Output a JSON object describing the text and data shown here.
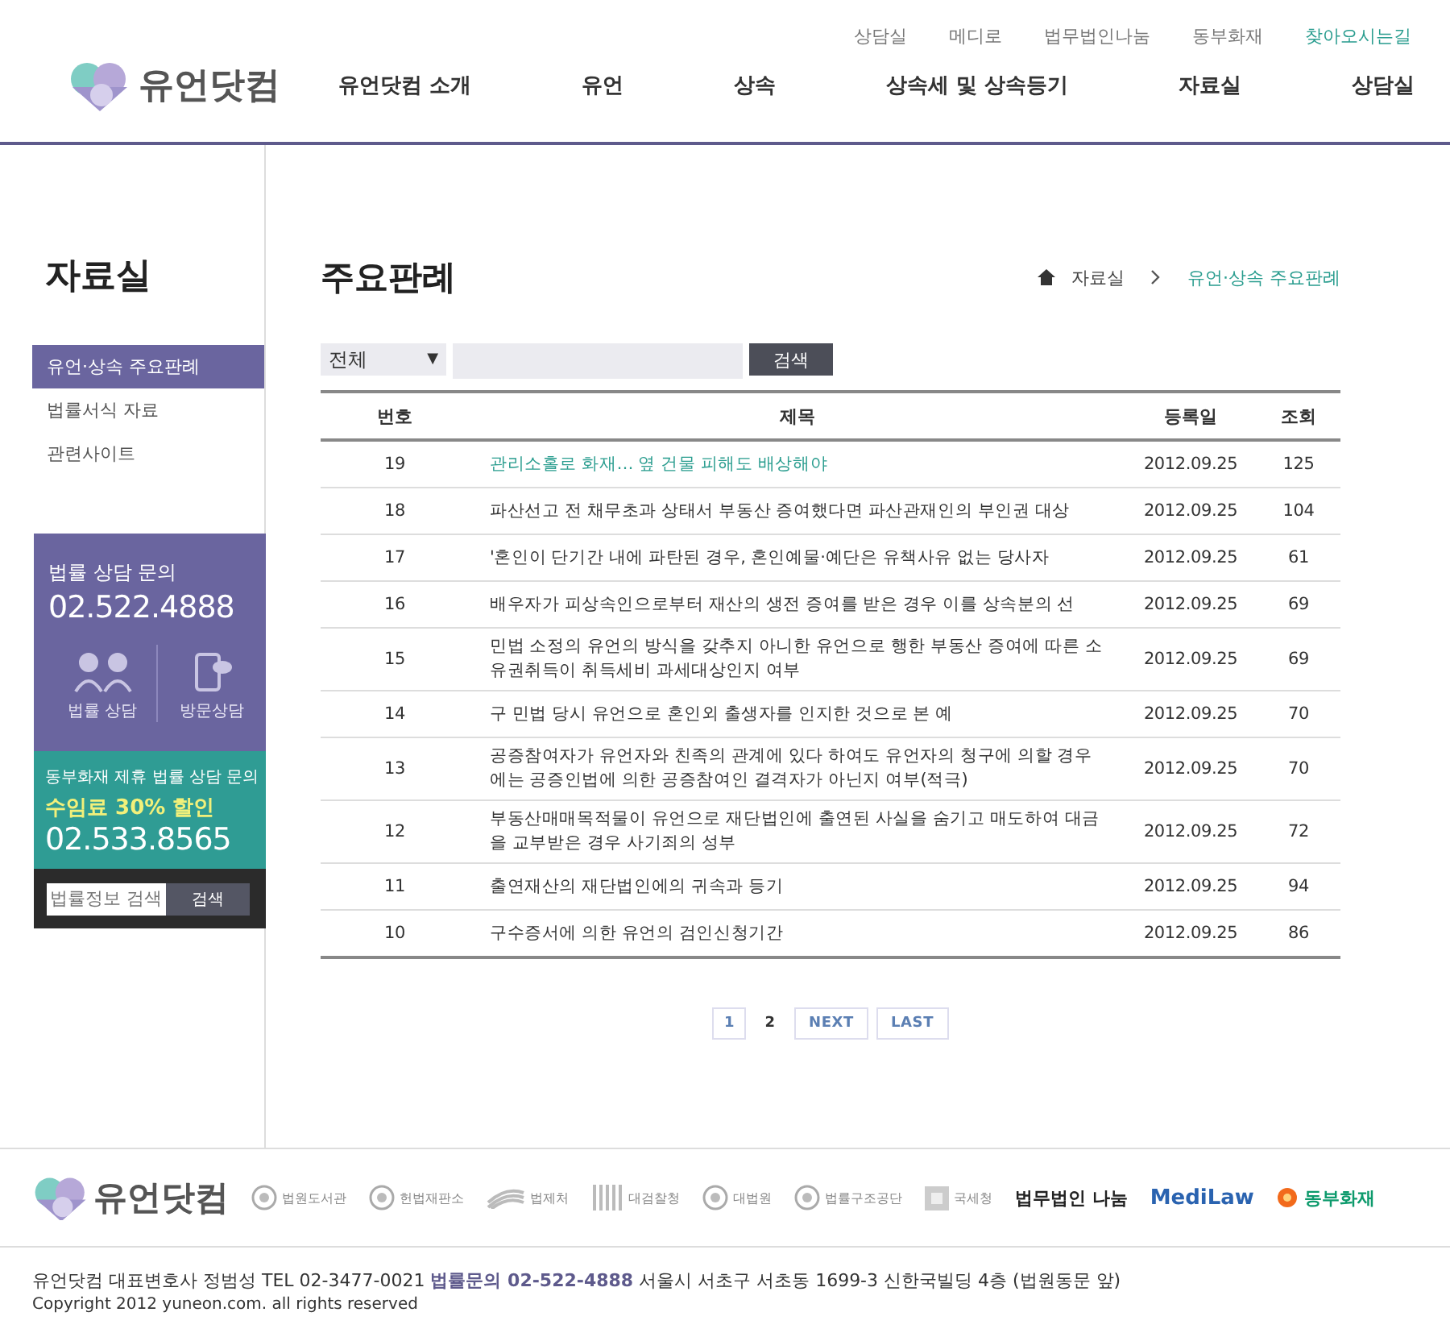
{
  "header": {
    "logo": "유언닷컴",
    "util_links": [
      {
        "label": "상담실",
        "highlighted": false
      },
      {
        "label": "메디로",
        "highlighted": false
      },
      {
        "label": "법무법인나눔",
        "highlighted": false
      },
      {
        "label": "동부화재",
        "highlighted": false
      },
      {
        "label": "찾아오시는길",
        "highlighted": true
      }
    ],
    "nav": [
      "유언닷컴 소개",
      "유언",
      "상속",
      "상속세 및 상속등기",
      "자료실",
      "상담실"
    ]
  },
  "sidebar": {
    "title": "자료실",
    "items": [
      {
        "label": "유언·상속 주요판례",
        "selected": true
      },
      {
        "label": "법률서식 자료",
        "selected": false
      },
      {
        "label": "관련사이트",
        "selected": false
      }
    ],
    "consult": {
      "caption": "법률 상담 문의",
      "phone": "02.522.4888",
      "actions": [
        {
          "label": "법률 상담",
          "kind": "people"
        },
        {
          "label": "방문상담",
          "kind": "phone"
        }
      ]
    },
    "partner": {
      "caption": "동부화재 제휴 법률 상담 문의",
      "offer": "수임료 30% 할인",
      "phone": "02.533.8565"
    },
    "search": {
      "placeholder": "법률정보 검색",
      "button": "검색"
    }
  },
  "main": {
    "title": "주요판례",
    "breadcrumb": [
      "자료실",
      "유언·상속 주요판례"
    ],
    "filter": {
      "value": "전체",
      "caret": "▼",
      "button": "검색"
    },
    "table": {
      "columns": [
        "번호",
        "제목",
        "등록일",
        "조회"
      ],
      "rows": [
        {
          "no": "19",
          "title": "관리소홀로 화재… 옆 건물 피해도 배상해야",
          "date": "2012.09.25",
          "views": "125",
          "highlighted": true
        },
        {
          "no": "18",
          "title": "파산선고 전 채무초과 상태서 부동산 증여했다면 파산관재인의 부인권 대상",
          "date": "2012.09.25",
          "views": "104",
          "highlighted": false
        },
        {
          "no": "17",
          "title": "'혼인이 단기간 내에 파탄된 경우, 혼인예물·예단은 유책사유 없는 당사자",
          "date": "2012.09.25",
          "views": "61",
          "highlighted": false
        },
        {
          "no": "16",
          "title": "배우자가 피상속인으로부터 재산의 생전 증여를 받은 경우 이를 상속분의 선",
          "date": "2012.09.25",
          "views": "69",
          "highlighted": false
        },
        {
          "no": "15",
          "title": "민법 소정의 유언의 방식을 갖추지 아니한 유언으로 행한 부동산 증여에 따른 소유권취득이 취득세비 과세대상인지 여부",
          "date": "2012.09.25",
          "views": "69",
          "highlighted": false
        },
        {
          "no": "14",
          "title": "구 민법 당시 유언으로 혼인외 출생자를 인지한 것으로 본 예",
          "date": "2012.09.25",
          "views": "70",
          "highlighted": false
        },
        {
          "no": "13",
          "title": "공증참여자가 유언자와 친족의 관계에 있다 하여도 유언자의 청구에 의할 경우에는 공증인법에 의한 공증참여인 결격자가 아닌지 여부(적극)",
          "date": "2012.09.25",
          "views": "70",
          "highlighted": false
        },
        {
          "no": "12",
          "title": "부동산매매목적물이 유언으로 재단법인에 출연된 사실을 숨기고 매도하여 대금을 교부받은 경우 사기죄의 성부",
          "date": "2012.09.25",
          "views": "72",
          "highlighted": false
        },
        {
          "no": "11",
          "title": "출연재산의 재단법인에의 귀속과 등기",
          "date": "2012.09.25",
          "views": "94",
          "highlighted": false
        },
        {
          "no": "10",
          "title": "구수증서에 의한 유언의 검인신청기간",
          "date": "2012.09.25",
          "views": "86",
          "highlighted": false
        }
      ]
    },
    "pagination": [
      {
        "label": "1",
        "selected": false,
        "kind": "page"
      },
      {
        "label": "2",
        "selected": true,
        "kind": "page"
      },
      {
        "label": "NEXT",
        "selected": false,
        "kind": "nav"
      },
      {
        "label": "LAST",
        "selected": false,
        "kind": "nav"
      }
    ]
  },
  "footer": {
    "logo": "유언닷컴",
    "partners": [
      {
        "label": "법원도서관",
        "kind": "seal"
      },
      {
        "label": "헌법재판소",
        "kind": "seal"
      },
      {
        "label": "법제처",
        "kind": "wave"
      },
      {
        "label": "대검찰청",
        "kind": "bars"
      },
      {
        "label": "대법원",
        "kind": "seal"
      },
      {
        "label": "법률구조공단",
        "kind": "seal"
      },
      {
        "label": "국세청",
        "kind": "square"
      },
      {
        "label": "법무법인 나눔",
        "kind": "text"
      },
      {
        "label": "MediLaw",
        "kind": "medilaw"
      },
      {
        "label": "동부화재",
        "kind": "flower"
      }
    ],
    "address_parts": [
      "유언닷컴 대표변호사 정범성 TEL 02-3477-0021",
      "법률문의 02-522-4888",
      "서울시 서초구 서초동 1699-3 신한국빌딩 4층 (법원동문 앞)"
    ],
    "copyright": "Copyright 2012 yuneon.com. all rights reserved"
  }
}
